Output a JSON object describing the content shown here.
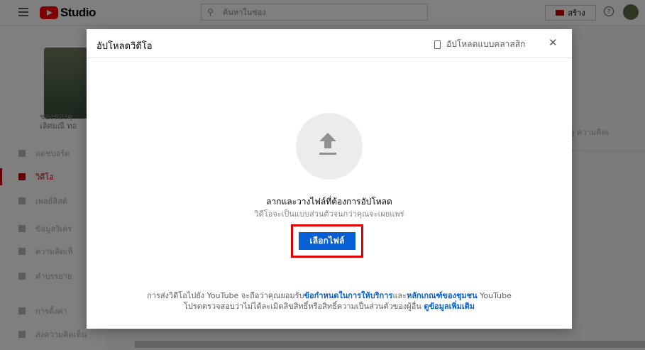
{
  "topbar": {
    "logo_text": "Studio",
    "search_placeholder": "ค้นหาในช่อง",
    "create_label": "สร้าง",
    "help_glyph": "?"
  },
  "sidebar": {
    "channel_title": "ช่องของคุ",
    "channel_owner": "เลิศมณี ทอ",
    "items": [
      {
        "label": "แดชบอร์ด",
        "icon": "dashboard-icon"
      },
      {
        "label": "วิดีโอ",
        "icon": "video-icon",
        "active": true
      },
      {
        "label": "เพลย์ลิสต์",
        "icon": "playlist-icon"
      },
      {
        "label": "ข้อมูลวิเคร",
        "icon": "analytics-icon"
      },
      {
        "label": "ความคิดเห็",
        "icon": "comments-icon"
      },
      {
        "label": "คำบรรยาย",
        "icon": "subtitles-icon"
      },
      {
        "label": "การตั้งค่า",
        "icon": "settings-icon"
      },
      {
        "label": "ส่งความคิดเห็น",
        "icon": "feedback-icon"
      }
    ]
  },
  "background": {
    "tabs_text": "รอดู   ความคิดเ"
  },
  "dialog": {
    "title": "อัปโหลดวิดีโอ",
    "classic_label": "อัปโหลดแบบคลาสสิก",
    "close_glyph": "✕",
    "drag_text": "ลากและวางไฟล์ที่ต้องการอัปโหลด",
    "private_text": "วิดีโอจะเป็นแบบส่วนตัวจนกว่าคุณจะเผยแพร่",
    "select_button": "เลือกไฟล์",
    "terms": {
      "part1": "การส่งวิดีโอไปยัง YouTube จะถือว่าคุณยอมรับ",
      "link1": "ข้อกำหนดในการให้บริการ",
      "part2": "และ",
      "link2": "หลักเกณฑ์ของชุมชน",
      "part3": " YouTube",
      "line2": "โปรดตรวจสอบว่าไม่ได้ละเมิดลิขสิทธิ์หรือสิทธิ์ความเป็นส่วนตัวของผู้อื่น ",
      "link3": "ดูข้อมูลเพิ่มเติม"
    }
  },
  "colors": {
    "accent_blue": "#065fd4",
    "highlight_red": "#e00000",
    "youtube_red": "#ff0000"
  }
}
